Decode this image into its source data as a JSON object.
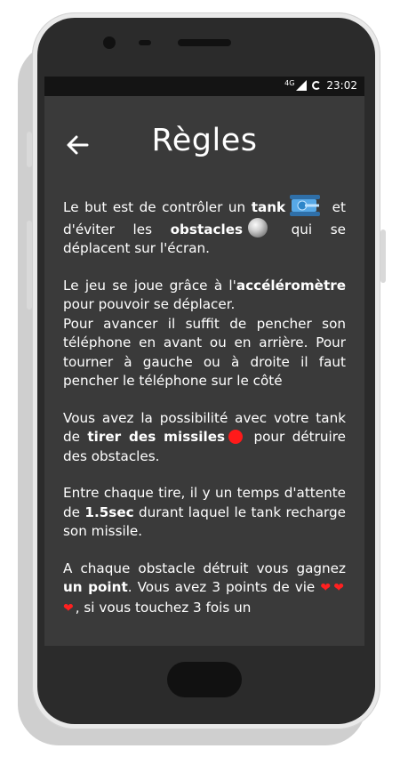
{
  "status_bar": {
    "network": "4G",
    "time": "23:02"
  },
  "header": {
    "title": "Règles"
  },
  "rules": {
    "p1_a": "Le but est de contrôler un ",
    "p1_tank": "tank",
    "p1_b": " et d'éviter les ",
    "p1_obstacles": "obstacles",
    "p1_c": " qui se déplacent sur l'écran.",
    "p2_a": "Le jeu se joue grâce à l'",
    "p2_acc": "accéléromètre",
    "p2_b": " pour pouvoir se déplacer.",
    "p2_c": "Pour avancer il suffit de pencher son téléphone en avant ou en arrière. Pour tourner à gauche ou à droite il faut pencher le téléphone sur le côté",
    "p3_a": "Vous avez la possibilité avec votre tank de ",
    "p3_missiles": "tirer des missiles",
    "p3_b": " pour détruire des obstacles.",
    "p4_a": "Entre chaque tire, il y un temps d'attente de ",
    "p4_time": "1.5sec",
    "p4_b": " durant laquel le tank recharge son missile.",
    "p5_a": "A chaque obstacle détruit vous gagnez ",
    "p5_point": "un point",
    "p5_b": ". Vous avez 3 points de vie",
    "p5_hearts": "❤❤❤",
    "p5_c": ", si vous touchez 3 fois un"
  },
  "icons": {
    "back": "arrow-left-icon",
    "tank": "tank-icon",
    "obstacle": "gray-ball-icon",
    "missile": "red-dot-icon",
    "heart": "heart-icon"
  },
  "colors": {
    "screen_bg": "#3a3a3a",
    "status_bg": "#141414",
    "text": "#ffffff",
    "missile": "#ff1a1a",
    "heart": "#ff2020",
    "tank": "#3a8fd0"
  }
}
